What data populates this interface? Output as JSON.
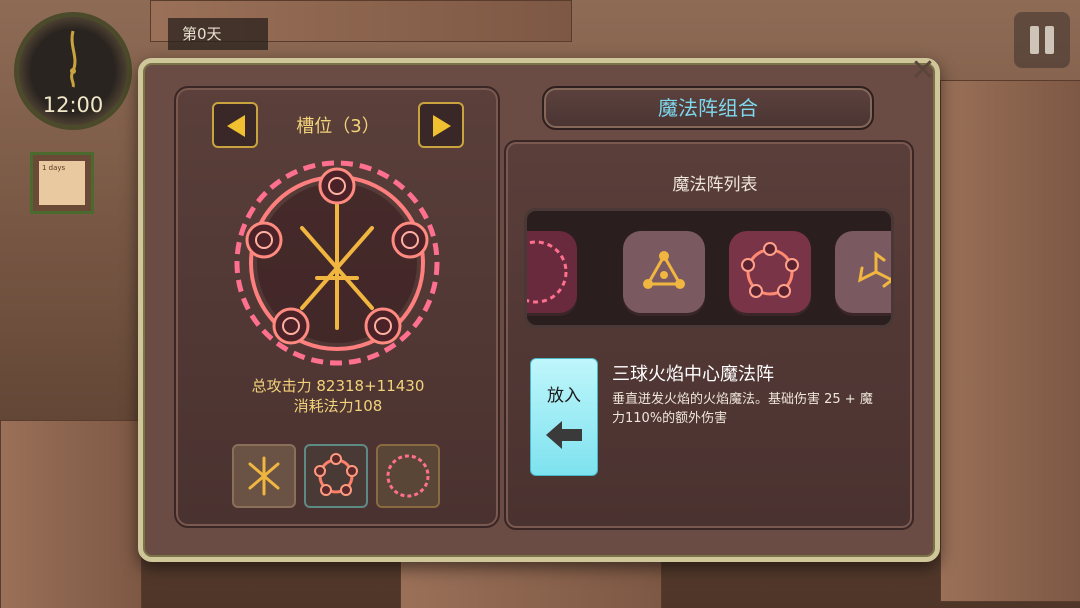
{
  "hud": {
    "time": "12:00",
    "day": "第0天",
    "note_text": "1 days",
    "pause_icon": "pause-icon"
  },
  "dialog": {
    "title": "魔法阵组合",
    "close_icon": "close-icon",
    "slot_panel": {
      "slot_label": "槽位（3）",
      "prev_icon": "triangle-left-icon",
      "next_icon": "triangle-right-icon",
      "total_attack": "总攻击力 82318+11430",
      "mana_cost": "消耗法力108",
      "equipped": [
        "lightning-rune-icon",
        "pentagram-fire-icon",
        "ring-circle-icon"
      ]
    },
    "list_panel": {
      "title": "魔法阵列表",
      "items": [
        "ring-circle-icon",
        "triangle-orbs-icon",
        "pentagram-fire-icon",
        "swirl-rune-icon"
      ],
      "selected_index": 2
    },
    "detail": {
      "put_label": "放入",
      "put_icon": "arrow-left-icon",
      "name": "三球火焰中心魔法阵",
      "description": "垂直迸发火焰的火焰魔法。基础伤害 25 + 魔力110%的额外伤害"
    }
  },
  "colors": {
    "gold": "#f2d27a",
    "title_cyan": "#7ed8ee",
    "rune_pink": "#ff6f8e",
    "rune_gold": "#f0b640"
  }
}
